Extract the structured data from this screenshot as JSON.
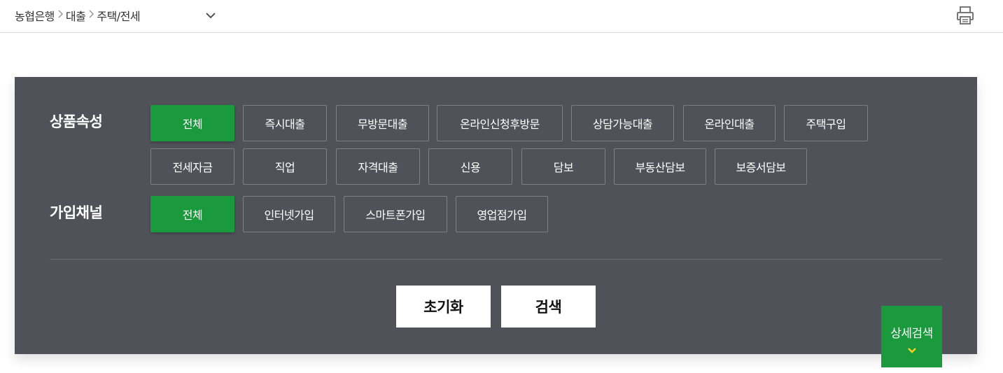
{
  "breadcrumb": {
    "items": [
      "농협은행",
      "대출",
      "주택/전세"
    ]
  },
  "filters": {
    "product_attribute": {
      "label": "상품속성",
      "options": [
        "전체",
        "즉시대출",
        "무방문대출",
        "온라인신청후방문",
        "상담가능대출",
        "온라인대출",
        "주택구입",
        "전세자금",
        "직업",
        "자격대출",
        "신용",
        "담보",
        "부동산담보",
        "보증서담보"
      ],
      "selected": "전체"
    },
    "join_channel": {
      "label": "가입채널",
      "options": [
        "전체",
        "인터넷가입",
        "스마트폰가입",
        "영업점가입"
      ],
      "selected": "전체"
    }
  },
  "actions": {
    "reset_label": "초기화",
    "search_label": "검색"
  },
  "detail_search": {
    "label": "상세검색",
    "icon": "chevron-down-icon"
  },
  "icons": {
    "print": "printer-icon",
    "dropdown": "chevron-down-icon"
  },
  "colors": {
    "panel_bg": "#505259",
    "accent_green": "#1a9a3c",
    "chevron_yellow": "#f5d020"
  }
}
